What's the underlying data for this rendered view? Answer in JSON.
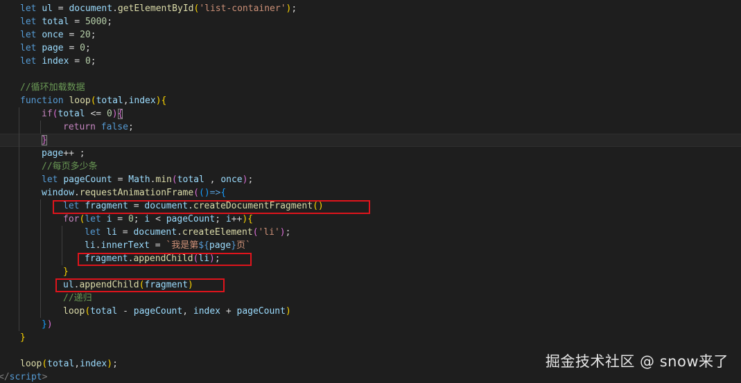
{
  "editor": {
    "language": "javascript",
    "theme": "dark",
    "lines": [
      {
        "indent": 1,
        "tokens": [
          {
            "t": "kw",
            "v": "let"
          },
          {
            "t": "pun",
            "v": " "
          },
          {
            "t": "var",
            "v": "ul"
          },
          {
            "t": "pun",
            "v": " = "
          },
          {
            "t": "var",
            "v": "document"
          },
          {
            "t": "pun",
            "v": "."
          },
          {
            "t": "fn",
            "v": "getElementById"
          },
          {
            "t": "br1",
            "v": "("
          },
          {
            "t": "str",
            "v": "'list-container'"
          },
          {
            "t": "br1",
            "v": ")"
          },
          {
            "t": "pun",
            "v": ";"
          }
        ]
      },
      {
        "indent": 1,
        "tokens": [
          {
            "t": "kw",
            "v": "let"
          },
          {
            "t": "pun",
            "v": " "
          },
          {
            "t": "var",
            "v": "total"
          },
          {
            "t": "pun",
            "v": " = "
          },
          {
            "t": "num",
            "v": "5000"
          },
          {
            "t": "pun",
            "v": ";"
          }
        ]
      },
      {
        "indent": 1,
        "tokens": [
          {
            "t": "kw",
            "v": "let"
          },
          {
            "t": "pun",
            "v": " "
          },
          {
            "t": "var",
            "v": "once"
          },
          {
            "t": "pun",
            "v": " = "
          },
          {
            "t": "num",
            "v": "20"
          },
          {
            "t": "pun",
            "v": ";"
          }
        ]
      },
      {
        "indent": 1,
        "tokens": [
          {
            "t": "kw",
            "v": "let"
          },
          {
            "t": "pun",
            "v": " "
          },
          {
            "t": "var",
            "v": "page"
          },
          {
            "t": "pun",
            "v": " = "
          },
          {
            "t": "num",
            "v": "0"
          },
          {
            "t": "pun",
            "v": ";"
          }
        ]
      },
      {
        "indent": 1,
        "tokens": [
          {
            "t": "kw",
            "v": "let"
          },
          {
            "t": "pun",
            "v": " "
          },
          {
            "t": "var",
            "v": "index"
          },
          {
            "t": "pun",
            "v": " = "
          },
          {
            "t": "num",
            "v": "0"
          },
          {
            "t": "pun",
            "v": ";"
          }
        ]
      },
      {
        "indent": 0,
        "tokens": []
      },
      {
        "indent": 1,
        "tokens": [
          {
            "t": "com",
            "v": "//循环加载数据"
          }
        ]
      },
      {
        "indent": 1,
        "tokens": [
          {
            "t": "kw",
            "v": "function"
          },
          {
            "t": "pun",
            "v": " "
          },
          {
            "t": "fn",
            "v": "loop"
          },
          {
            "t": "br1",
            "v": "("
          },
          {
            "t": "var",
            "v": "total"
          },
          {
            "t": "pun",
            "v": ","
          },
          {
            "t": "var",
            "v": "index"
          },
          {
            "t": "br1",
            "v": ")"
          },
          {
            "t": "br1",
            "v": "{"
          }
        ]
      },
      {
        "indent": 2,
        "tokens": [
          {
            "t": "ctl",
            "v": "if"
          },
          {
            "t": "br2",
            "v": "("
          },
          {
            "t": "var",
            "v": "total"
          },
          {
            "t": "pun",
            "v": " <= "
          },
          {
            "t": "num",
            "v": "0"
          },
          {
            "t": "br2",
            "v": ")"
          },
          {
            "t": "br2 bracket-match",
            "v": "{"
          }
        ]
      },
      {
        "indent": 3,
        "tokens": [
          {
            "t": "ctl",
            "v": "return"
          },
          {
            "t": "pun",
            "v": " "
          },
          {
            "t": "kw",
            "v": "false"
          },
          {
            "t": "pun",
            "v": ";"
          }
        ]
      },
      {
        "indent": 2,
        "current": true,
        "tokens": [
          {
            "t": "br2 bracket-match",
            "v": "}"
          }
        ]
      },
      {
        "indent": 2,
        "tokens": [
          {
            "t": "var",
            "v": "page"
          },
          {
            "t": "pun",
            "v": "++ ;"
          }
        ]
      },
      {
        "indent": 2,
        "tokens": [
          {
            "t": "com",
            "v": "//每页多少条"
          }
        ]
      },
      {
        "indent": 2,
        "tokens": [
          {
            "t": "kw",
            "v": "let"
          },
          {
            "t": "pun",
            "v": " "
          },
          {
            "t": "var",
            "v": "pageCount"
          },
          {
            "t": "pun",
            "v": " = "
          },
          {
            "t": "var",
            "v": "Math"
          },
          {
            "t": "pun",
            "v": "."
          },
          {
            "t": "fn",
            "v": "min"
          },
          {
            "t": "br2",
            "v": "("
          },
          {
            "t": "var",
            "v": "total"
          },
          {
            "t": "pun",
            "v": " , "
          },
          {
            "t": "var",
            "v": "once"
          },
          {
            "t": "br2",
            "v": ")"
          },
          {
            "t": "pun",
            "v": ";"
          }
        ]
      },
      {
        "indent": 2,
        "tokens": [
          {
            "t": "var",
            "v": "window"
          },
          {
            "t": "pun",
            "v": "."
          },
          {
            "t": "fn",
            "v": "requestAnimationFrame"
          },
          {
            "t": "br2",
            "v": "("
          },
          {
            "t": "br3",
            "v": "()"
          },
          {
            "t": "kw",
            "v": "=>"
          },
          {
            "t": "br3",
            "v": "{"
          }
        ]
      },
      {
        "indent": 3,
        "tokens": [
          {
            "t": "kw",
            "v": "let"
          },
          {
            "t": "pun",
            "v": " "
          },
          {
            "t": "var",
            "v": "fragment"
          },
          {
            "t": "pun",
            "v": " = "
          },
          {
            "t": "var",
            "v": "document"
          },
          {
            "t": "pun",
            "v": "."
          },
          {
            "t": "fn",
            "v": "createDocumentFragment"
          },
          {
            "t": "br1",
            "v": "()"
          }
        ]
      },
      {
        "indent": 3,
        "tokens": [
          {
            "t": "ctl",
            "v": "for"
          },
          {
            "t": "br1",
            "v": "("
          },
          {
            "t": "kw",
            "v": "let"
          },
          {
            "t": "pun",
            "v": " "
          },
          {
            "t": "var",
            "v": "i"
          },
          {
            "t": "pun",
            "v": " = "
          },
          {
            "t": "num",
            "v": "0"
          },
          {
            "t": "pun",
            "v": "; "
          },
          {
            "t": "var",
            "v": "i"
          },
          {
            "t": "pun",
            "v": " < "
          },
          {
            "t": "var",
            "v": "pageCount"
          },
          {
            "t": "pun",
            "v": "; "
          },
          {
            "t": "var",
            "v": "i"
          },
          {
            "t": "pun",
            "v": "++"
          },
          {
            "t": "br1",
            "v": ")"
          },
          {
            "t": "br1",
            "v": "{"
          }
        ]
      },
      {
        "indent": 4,
        "tokens": [
          {
            "t": "kw",
            "v": "let"
          },
          {
            "t": "pun",
            "v": " "
          },
          {
            "t": "var",
            "v": "li"
          },
          {
            "t": "pun",
            "v": " = "
          },
          {
            "t": "var",
            "v": "document"
          },
          {
            "t": "pun",
            "v": "."
          },
          {
            "t": "fn",
            "v": "createElement"
          },
          {
            "t": "br2",
            "v": "("
          },
          {
            "t": "str",
            "v": "'li'"
          },
          {
            "t": "br2",
            "v": ")"
          },
          {
            "t": "pun",
            "v": ";"
          }
        ]
      },
      {
        "indent": 4,
        "tokens": [
          {
            "t": "var",
            "v": "li"
          },
          {
            "t": "pun",
            "v": "."
          },
          {
            "t": "var",
            "v": "innerText"
          },
          {
            "t": "pun",
            "v": " = "
          },
          {
            "t": "str",
            "v": "`我是第"
          },
          {
            "t": "kw",
            "v": "${"
          },
          {
            "t": "var",
            "v": "page"
          },
          {
            "t": "kw",
            "v": "}"
          },
          {
            "t": "str",
            "v": "页`"
          }
        ]
      },
      {
        "indent": 4,
        "tokens": [
          {
            "t": "var",
            "v": "fragment"
          },
          {
            "t": "pun",
            "v": "."
          },
          {
            "t": "fn",
            "v": "appendChild"
          },
          {
            "t": "br2",
            "v": "("
          },
          {
            "t": "var",
            "v": "li"
          },
          {
            "t": "br2",
            "v": ")"
          },
          {
            "t": "pun",
            "v": ";"
          }
        ]
      },
      {
        "indent": 3,
        "tokens": [
          {
            "t": "br1",
            "v": "}"
          }
        ]
      },
      {
        "indent": 3,
        "tokens": [
          {
            "t": "var",
            "v": "ul"
          },
          {
            "t": "pun",
            "v": "."
          },
          {
            "t": "fn",
            "v": "appendChild"
          },
          {
            "t": "br1",
            "v": "("
          },
          {
            "t": "var",
            "v": "fragment"
          },
          {
            "t": "br1",
            "v": ")"
          }
        ]
      },
      {
        "indent": 3,
        "tokens": [
          {
            "t": "com",
            "v": "//递归"
          }
        ]
      },
      {
        "indent": 3,
        "tokens": [
          {
            "t": "fn",
            "v": "loop"
          },
          {
            "t": "br1",
            "v": "("
          },
          {
            "t": "var",
            "v": "total"
          },
          {
            "t": "pun",
            "v": " - "
          },
          {
            "t": "var",
            "v": "pageCount"
          },
          {
            "t": "pun",
            "v": ", "
          },
          {
            "t": "var",
            "v": "index"
          },
          {
            "t": "pun",
            "v": " + "
          },
          {
            "t": "var",
            "v": "pageCount"
          },
          {
            "t": "br1",
            "v": ")"
          }
        ]
      },
      {
        "indent": 2,
        "tokens": [
          {
            "t": "br3",
            "v": "}"
          },
          {
            "t": "br2",
            "v": ")"
          }
        ]
      },
      {
        "indent": 1,
        "tokens": [
          {
            "t": "br1",
            "v": "}"
          }
        ]
      },
      {
        "indent": 0,
        "tokens": []
      },
      {
        "indent": 1,
        "tokens": [
          {
            "t": "fn",
            "v": "loop"
          },
          {
            "t": "br1",
            "v": "("
          },
          {
            "t": "var",
            "v": "total"
          },
          {
            "t": "pun",
            "v": ","
          },
          {
            "t": "var",
            "v": "index"
          },
          {
            "t": "br1",
            "v": ")"
          },
          {
            "t": "pun",
            "v": ";"
          }
        ]
      },
      {
        "indent": 0,
        "tokens": [
          {
            "t": "tag",
            "v": "</"
          },
          {
            "t": "tagname",
            "v": "script"
          },
          {
            "t": "tag",
            "v": ">"
          }
        ]
      }
    ],
    "highlight_boxes": [
      {
        "line": 15,
        "label": "let fragment = document.createDocumentFragment()"
      },
      {
        "line": 19,
        "label": "fragment.appendChild(li);"
      },
      {
        "line": 21,
        "label": "ul.appendChild(fragment)"
      }
    ]
  },
  "watermark": {
    "text": "掘金技术社区 @ snow来了"
  }
}
